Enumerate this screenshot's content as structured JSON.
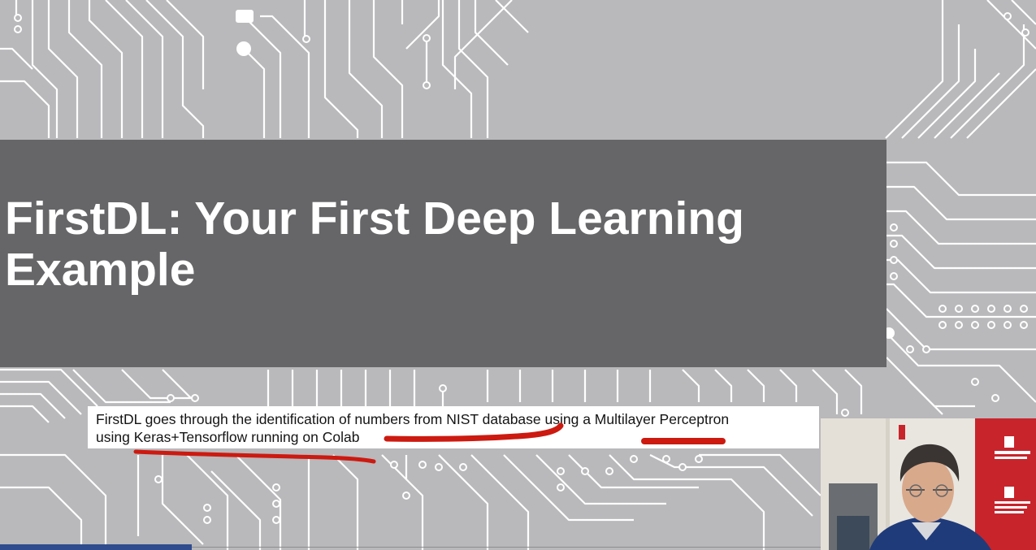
{
  "slide": {
    "title_line1": "FirstDL: Your First  Deep Learning",
    "title_line2": "Example",
    "caption_line1": "FirstDL goes through the identification of numbers from NIST database using a Multilayer Perceptron",
    "caption_line2": "using Keras+Tensorflow running on Colab"
  },
  "colors": {
    "background": "#b9b8bb",
    "title_band": "#666668",
    "annotation": "#cc1a10",
    "banner": "#c8242c"
  },
  "icons": {
    "webcam": "presenter-video-icon"
  }
}
